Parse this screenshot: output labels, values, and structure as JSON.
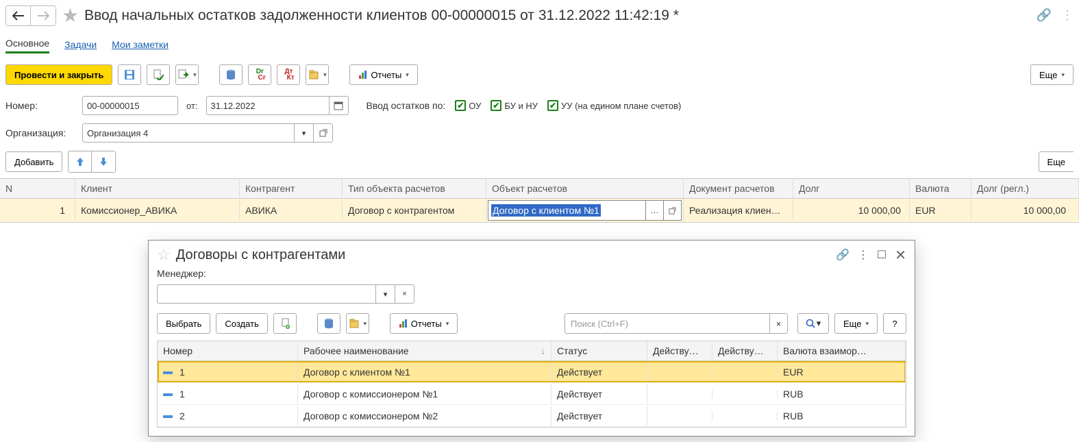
{
  "header": {
    "title": "Ввод начальных остатков задолженности клиентов 00-00000015 от 31.12.2022 11:42:19 *"
  },
  "tabs": {
    "main": "Основное",
    "tasks": "Задачи",
    "notes": "Мои заметки"
  },
  "toolbar": {
    "post_close": "Провести и закрыть",
    "reports": "Отчеты",
    "more": "Еще"
  },
  "form": {
    "number_label": "Номер:",
    "number_value": "00-00000015",
    "from_label": "от:",
    "date_value": "31.12.2022",
    "balances_label": "Ввод остатков по:",
    "chk_ou": "ОУ",
    "chk_bunu": "БУ и НУ",
    "chk_uu": "УУ (на едином плане счетов)",
    "org_label": "Организация:",
    "org_value": "Организация 4"
  },
  "table_toolbar": {
    "add": "Добавить",
    "more": "Еще"
  },
  "grid": {
    "headers": {
      "n": "N",
      "client": "Клиент",
      "kontr": "Контрагент",
      "tip": "Тип объекта расчетов",
      "obj": "Объект расчетов",
      "doc": "Документ расчетов",
      "debt": "Долг",
      "curr": "Валюта",
      "regl": "Долг (регл.)"
    },
    "row": {
      "n": "1",
      "client": "Комиссионер_АВИКА",
      "kontr": "АВИКА",
      "tip": "Договор с контрагентом",
      "obj": "Договор с клиентом №1",
      "doc": "Реализация клиен…",
      "debt": "10 000,00",
      "curr": "EUR",
      "regl": "10 000,00"
    }
  },
  "popup": {
    "title": "Договоры с контрагентами",
    "manager_label": "Менеджер:",
    "manager_value": "",
    "select": "Выбрать",
    "create": "Создать",
    "reports": "Отчеты",
    "search_placeholder": "Поиск (Ctrl+F)",
    "more": "Еще",
    "help": "?",
    "headers": {
      "num": "Номер",
      "name": "Рабочее наименование",
      "status": "Статус",
      "d1": "Действу…",
      "d2": "Действу…",
      "curr": "Валюта взаимор…"
    },
    "rows": [
      {
        "num": "1",
        "name": "Договор с клиентом №1",
        "status": "Действует",
        "d1": "",
        "d2": "",
        "curr": "EUR"
      },
      {
        "num": "1",
        "name": "Договор с комиссионером №1",
        "status": "Действует",
        "d1": "",
        "d2": "",
        "curr": "RUB"
      },
      {
        "num": "2",
        "name": "Договор с комиссионером №2",
        "status": "Действует",
        "d1": "",
        "d2": "",
        "curr": "RUB"
      }
    ]
  }
}
